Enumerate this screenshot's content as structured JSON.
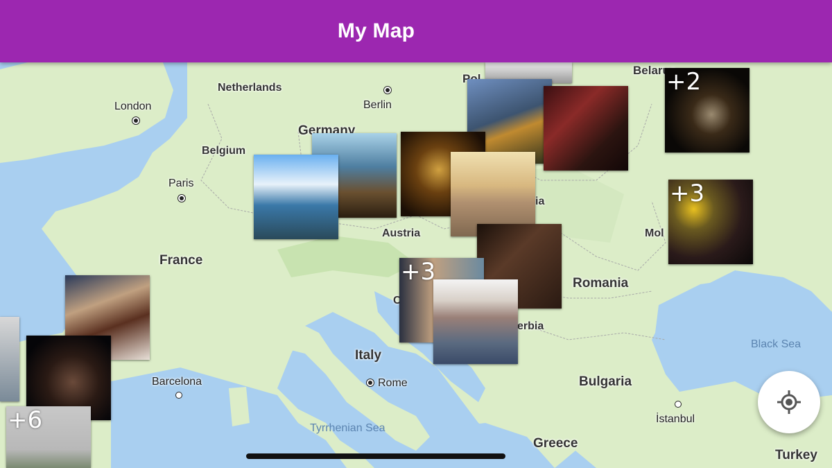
{
  "appbar": {
    "title": "My Map",
    "color": "#9c27b0"
  },
  "map": {
    "countries": [
      "Netherlands",
      "Germany",
      "Belgium",
      "France",
      "Austria",
      "Italy",
      "Romania",
      "Bulgaria",
      "Greece",
      "Turkey",
      "Belarus",
      "Poland",
      "Moldova",
      "Serbia"
    ],
    "country_labels": {
      "netherlands": "Netherlands",
      "germany": "Germany",
      "belgium": "Belgium",
      "france": "France",
      "austria": "Austria",
      "italy": "Italy",
      "romania": "Romania",
      "bulgaria": "Bulgaria",
      "greece": "Greece",
      "turkey": "Turkey",
      "belarus": "Belarus",
      "poland": "Pol",
      "moldova": "Mol",
      "serbia": "erbia",
      "hungary": "ia",
      "croatia": "C"
    },
    "cities": {
      "london": "London",
      "paris": "Paris",
      "berlin": "Berlin",
      "barcelona": "Barcelona",
      "rome": "Rome",
      "istanbul": "İstanbul"
    },
    "seas": {
      "black_sea": "Black Sea",
      "tyrrhenian_sea": "Tyrrhenian Sea"
    },
    "colors": {
      "water": "#a9cff0",
      "land": "#dcedc8",
      "land_dark": "#c8e3b0"
    }
  },
  "photo_clusters": [
    {
      "name": "belarus-cluster",
      "count_label": "+2"
    },
    {
      "name": "moldova-cluster",
      "count_label": "+3"
    },
    {
      "name": "croatia-cluster",
      "count_label": "+3"
    },
    {
      "name": "spain-cluster",
      "count_label": "+6"
    }
  ],
  "fab": {
    "icon": "my-location-icon"
  }
}
